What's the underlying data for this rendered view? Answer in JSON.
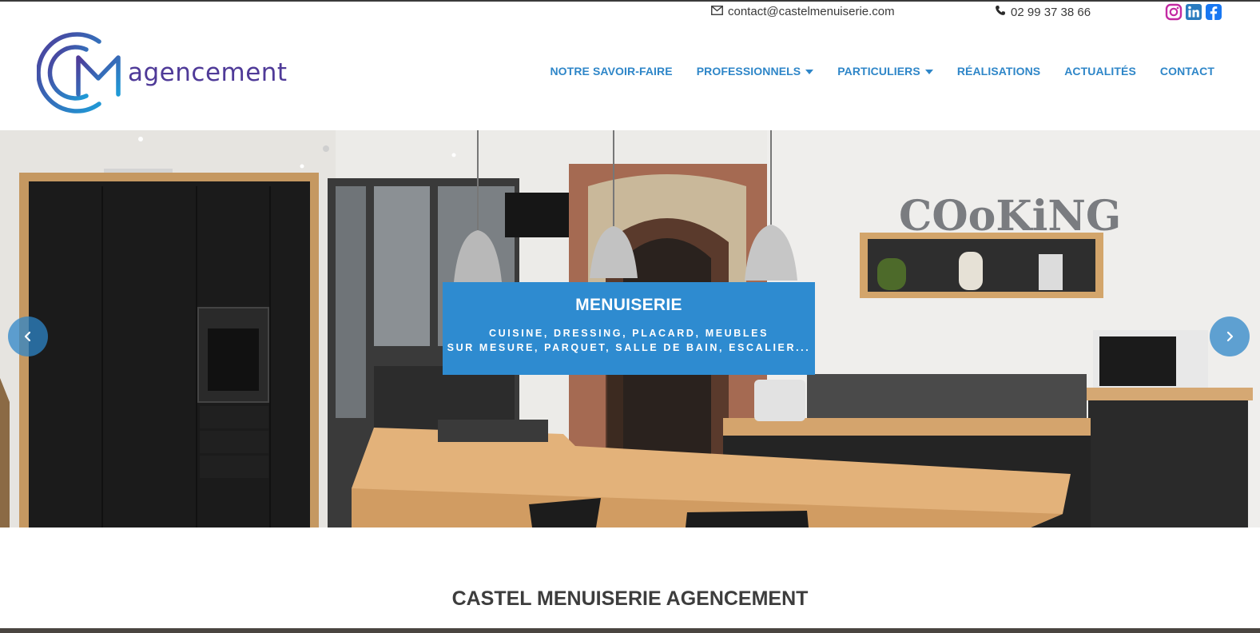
{
  "contact": {
    "email": "contact@castelmenuiserie.com",
    "phone": "02 99 37 38 66"
  },
  "socials": [
    {
      "icon": "instagram-icon",
      "color": "#c32aa3"
    },
    {
      "icon": "linkedin-icon",
      "color": "#0a66c2"
    },
    {
      "icon": "facebook-icon",
      "color": "#1877f2"
    }
  ],
  "logo": {
    "word": "agencement"
  },
  "nav": {
    "items": [
      {
        "label": "NOTRE SAVOIR-FAIRE",
        "dropdown": false
      },
      {
        "label": "PROFESSIONNELS",
        "dropdown": true
      },
      {
        "label": "PARTICULIERS",
        "dropdown": true
      },
      {
        "label": "RÉALISATIONS",
        "dropdown": false
      },
      {
        "label": "ACTUALITÉS",
        "dropdown": false
      },
      {
        "label": "CONTACT",
        "dropdown": false
      }
    ]
  },
  "hero": {
    "title": "MENUISERIE",
    "subtitle_line1": "CUISINE, DRESSING, PLACARD, MEUBLES",
    "subtitle_line2": "SUR MESURE, PARQUET, SALLE DE BAIN, ESCALIER...",
    "shelf_word": "COoKiNG"
  },
  "section": {
    "title": "CASTEL MENUISERIE AGENCEMENT"
  },
  "colors": {
    "accent": "#2e86c8",
    "caption_bg": "#2e8bd0",
    "logo_purple": "#4f3a98",
    "text_dark": "#3d3d3d"
  }
}
